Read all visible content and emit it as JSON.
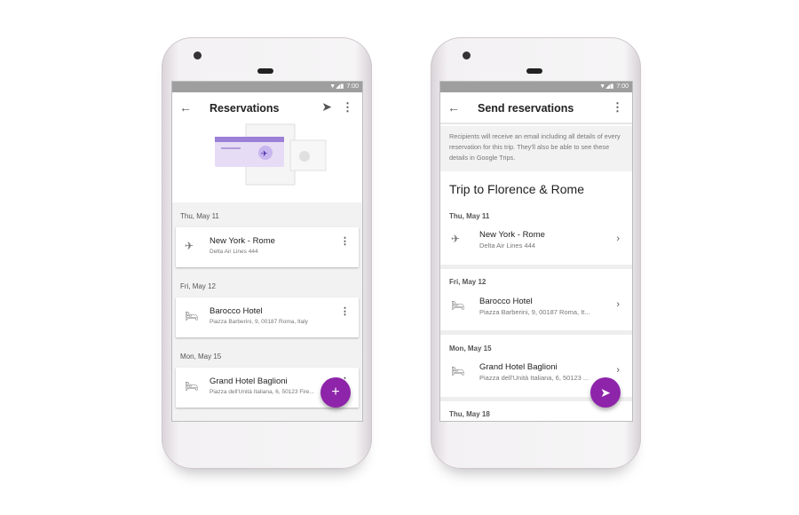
{
  "status": {
    "time": "7:00"
  },
  "left": {
    "title": "Reservations",
    "icons": {
      "back": "arrow-left-icon",
      "send": "send-icon",
      "more": "more-vert-icon"
    },
    "groups": [
      {
        "date": "Thu, May 11",
        "name": "New York - Rome",
        "sub": "Delta Air Lines 444",
        "icon": "flight-icon"
      },
      {
        "date": "Fri, May 12",
        "name": "Barocco Hotel",
        "sub": "Piazza Barberini, 9, 00187 Roma, Italy",
        "icon": "hotel-icon"
      },
      {
        "date": "Mon, May 15",
        "name": "Grand Hotel Baglioni",
        "sub": "Piazza dell'Unità Italiana, 6, 50123 Fire...",
        "icon": "hotel-icon"
      }
    ],
    "fab": "+"
  },
  "right": {
    "title": "Send reservations",
    "info": "Recipients will receive an email including all details of every reservation for this trip. They'll also be able to see these details in Google Trips.",
    "trip": "Trip to Florence & Rome",
    "groups": [
      {
        "date": "Thu, May 11",
        "name": "New York - Rome",
        "sub": "Delta Air Lines 444"
      },
      {
        "date": "Fri, May 12",
        "name": "Barocco Hotel",
        "sub": "Piazza Barberini, 9, 00187 Roma, It..."
      },
      {
        "date": "Mon, May 15",
        "name": "Grand Hotel Baglioni",
        "sub": "Piazza dell'Unità Italiana, 6, 50123 ..."
      },
      {
        "date": "Thu, May 18"
      }
    ]
  },
  "colors": {
    "accent": "#8e24aa",
    "statusbar": "#9e9e9e"
  }
}
